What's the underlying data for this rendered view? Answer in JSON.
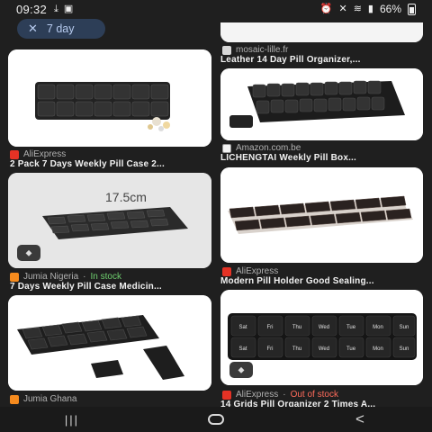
{
  "status": {
    "time": "09:32",
    "battery": "66%",
    "icons": [
      "download-icon",
      "gallery-icon",
      "alarm-icon",
      "mute-icon",
      "wifi-icon",
      "signal-icon",
      "battery-icon"
    ]
  },
  "filter_chip": {
    "close_glyph": "✕",
    "label": "7 day"
  },
  "results": [
    {
      "id": "r1",
      "source": "AliExpress",
      "title": "2 Pack 7 Days Weekly Pill Case 2...",
      "favicon": "aliexpress"
    },
    {
      "id": "r2",
      "source": "mosaic-lille.fr",
      "title": "Leather 14 Day Pill Organizer,...",
      "favicon": "mosaic"
    },
    {
      "id": "r3",
      "source": "Amazon.com.be",
      "title": "LICHENGTAI Weekly Pill Box...",
      "favicon": "amazon"
    },
    {
      "id": "r4",
      "source": "Jumia Nigeria",
      "stock": "In stock",
      "title": "7 Days Weekly Pill Case Medicin...",
      "favicon": "jumia",
      "image_text": "17.5cm"
    },
    {
      "id": "r5",
      "source": "AliExpress",
      "title": "Modern Pill Holder Good Sealing...",
      "favicon": "aliexpress"
    },
    {
      "id": "r6",
      "source": "Jumia Ghana",
      "title": "",
      "favicon": "jumia"
    },
    {
      "id": "r7",
      "source": "AliExpress",
      "stock": "Out of stock",
      "title": "14 Grids Pill Organizer 2 Times A...",
      "favicon": "aliexpress"
    }
  ],
  "stock_separator": " · ",
  "pill_day_labels": [
    "Sat",
    "Fri",
    "Thu",
    "Wed",
    "Tue",
    "Mon",
    "Sun"
  ],
  "nav": {
    "recents": "|||",
    "back": "<"
  },
  "colors": {
    "background": "#1f1f1f",
    "chip": "#2d3e57",
    "in_stock": "#6fcf6f",
    "out_of_stock": "#ff6b5b"
  }
}
